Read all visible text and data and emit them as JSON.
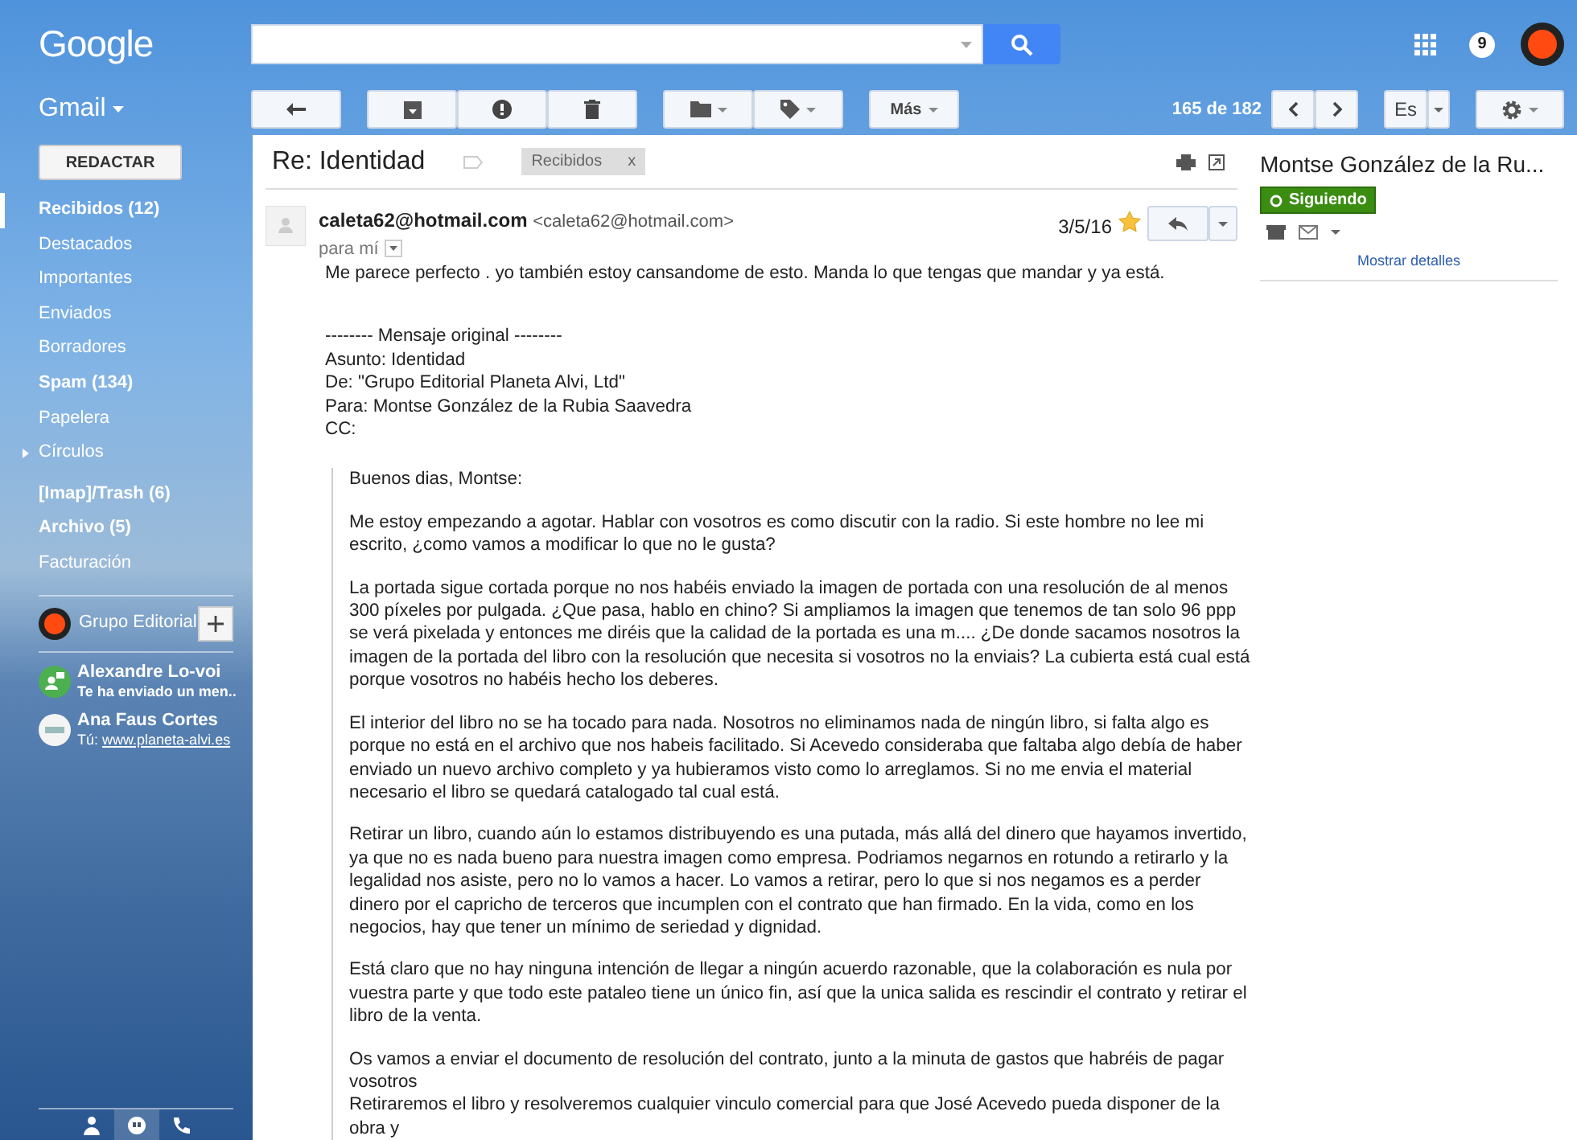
{
  "header": {
    "logo": "Google",
    "notifications": "9"
  },
  "product": "Gmail",
  "toolbar": {
    "more": "Más",
    "counter": "165 de 182",
    "language": "Es"
  },
  "compose": "REDACTAR",
  "sidebar": {
    "items": [
      {
        "label": "Recibidos (12)",
        "bold": true,
        "selected": true,
        "kind": "folder"
      },
      {
        "label": "Destacados",
        "bold": false,
        "selected": false,
        "kind": "folder"
      },
      {
        "label": "Importantes",
        "bold": false,
        "selected": false,
        "kind": "folder"
      },
      {
        "label": "Enviados",
        "bold": false,
        "selected": false,
        "kind": "folder"
      },
      {
        "label": "Borradores",
        "bold": false,
        "selected": false,
        "kind": "folder"
      },
      {
        "label": "Spam (134)",
        "bold": true,
        "selected": false,
        "kind": "folder"
      },
      {
        "label": "Papelera",
        "bold": false,
        "selected": false,
        "kind": "folder"
      },
      {
        "label": "Círculos",
        "bold": false,
        "selected": false,
        "kind": "group"
      },
      {
        "label": "[Imap]/Trash (6)",
        "bold": true,
        "selected": false,
        "kind": "folder"
      },
      {
        "label": "Archivo (5)",
        "bold": true,
        "selected": false,
        "kind": "folder"
      },
      {
        "label": "Facturación",
        "bold": false,
        "selected": false,
        "kind": "folder"
      }
    ]
  },
  "hangouts": {
    "account": "Grupo Editorial",
    "contacts": [
      {
        "name": "Alexandre Lo-voi",
        "status": "Te ha enviado un men..",
        "kind": "message"
      },
      {
        "name": "Ana Faus Cortes",
        "status": "Tú:",
        "link": "www.planeta-alvi.es",
        "kind": "site"
      }
    ],
    "tabs": [
      {
        "kind": "people",
        "selected": false
      },
      {
        "kind": "chat",
        "selected": true
      },
      {
        "kind": "phone",
        "selected": false
      }
    ]
  },
  "message": {
    "subject": "Re: Identidad",
    "label": "Recibidos",
    "label_close": "x",
    "sender": "caleta62@hotmail.com",
    "sender_address": "<caleta62@hotmail.com>",
    "date": "3/5/16",
    "starred": true,
    "to": "para mí",
    "reply": "Me parece perfecto . yo también estoy cansandome de esto. Manda lo que tengas que mandar y ya está.",
    "original": [
      "-------- Mensaje original --------",
      "Asunto: Identidad",
      "De: \"Grupo Editorial Planeta Alvi, Ltd\"",
      "Para: Montse González de la Rubia Saavedra",
      "CC:"
    ],
    "quote": [
      [
        "Buenos dias, Montse:"
      ],
      [
        "Me estoy empezando a agotar. Hablar con vosotros es como discutir con la radio. Si este hombre no lee mi escrito, ¿como vamos a modificar lo que no le gusta?"
      ],
      [
        "La portada sigue cortada porque no nos habéis enviado la imagen de portada con una resolución de al menos 300 píxeles por pulgada. ¿Que pasa, hablo en chino? Si ampliamos la imagen que tenemos de tan solo 96 ppp se verá pixelada y entonces me diréis que la calidad de la portada es una m.... ¿De donde sacamos nosotros la imagen de la portada del libro con la resolución que necesita si vosotros no la enviais? La cubierta está cual está porque vosotros no habéis hecho los deberes."
      ],
      [
        "El interior del libro no se ha tocado para nada. Nosotros no eliminamos nada de ningún libro, si falta algo es porque no está en el archivo que nos habeis facilitado. Si Acevedo consideraba que faltaba algo debía de haber enviado un nuevo archivo completo y ya hubieramos visto como lo arreglamos. Si no me envia el material necesario el libro se quedará catalogado tal cual está."
      ],
      [
        "Retirar un libro, cuando aún lo estamos distribuyendo es una putada, más allá del dinero que hayamos invertido, ya que no es nada bueno para nuestra imagen como empresa. Podriamos negarnos en rotundo a retirarlo y la legalidad nos asiste, pero no lo vamos a hacer. Lo vamos a retirar, pero lo que si nos negamos es a perder dinero por el capricho de terceros que incumplen con el contrato que han firmado. En la vida, como en los negocios, hay que tener un mínimo de seriedad y dignidad."
      ],
      [
        "Está claro que no hay ninguna intención de llegar a ningún acuerdo razonable, que la colaboración es nula por vuestra parte y que todo este pataleo tiene un único fin, así que la unica salida es rescindir el contrato y retirar el libro de la venta."
      ],
      [
        "Os vamos a enviar el documento de resolución del contrato, junto a la minuta de gastos que habréis de pagar vosotros",
        "Retiraremos el libro y resolveremos cualquier vinculo comercial para que José Acevedo pueda disponer de la obra y"
      ]
    ]
  },
  "contact": {
    "name": "Montse González de la Ru...",
    "following": "Siguiendo",
    "details": "Mostrar detalles"
  }
}
